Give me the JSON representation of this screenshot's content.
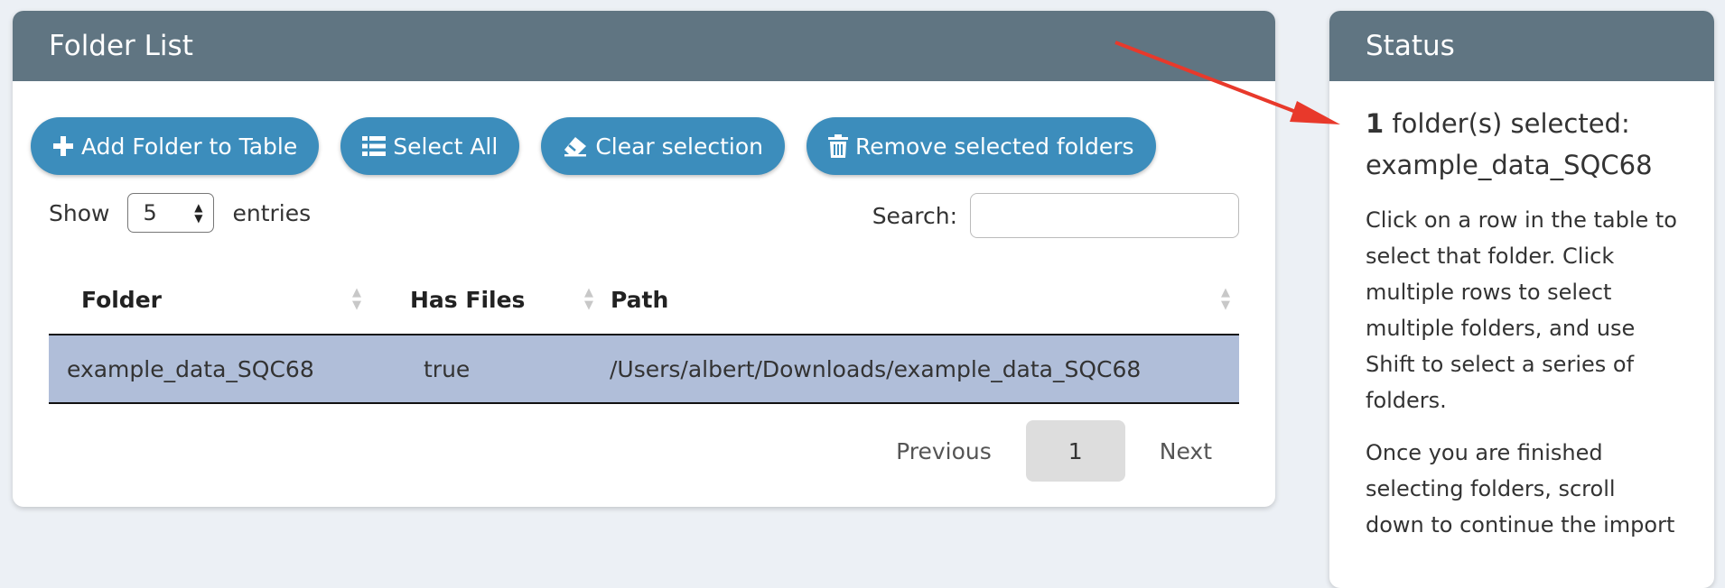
{
  "folder_panel": {
    "title": "Folder List",
    "buttons": {
      "add": "Add Folder to Table",
      "select_all": "Select All",
      "clear": "Clear selection",
      "remove": "Remove selected folders"
    },
    "show_label": "Show",
    "entries_value": "5",
    "entries_label": "entries",
    "search_label": "Search:",
    "search_value": "",
    "columns": [
      "Folder",
      "Has Files",
      "Path"
    ],
    "rows": [
      {
        "folder": "example_data_SQC68",
        "has_files": "true",
        "path": "/Users/albert/Downloads/example_data_SQC68"
      }
    ],
    "pagination": {
      "previous": "Previous",
      "current": "1",
      "next": "Next"
    }
  },
  "status_panel": {
    "title": "Status",
    "count": "1",
    "selected_text": " folder(s) selected:",
    "selected_name": "example_data_SQC68",
    "help_1": "Click on a row in the table to select that folder. Click multiple rows to select multiple folders, and use Shift to select a series of folders.",
    "help_2": "Once you are finished selecting folders, scroll down to continue the import"
  },
  "colors": {
    "header": "#607582",
    "button": "#3c8dbc",
    "selected_row": "#b0bed9",
    "annotation_arrow": "#e8392b",
    "background": "#ecf0f5"
  }
}
